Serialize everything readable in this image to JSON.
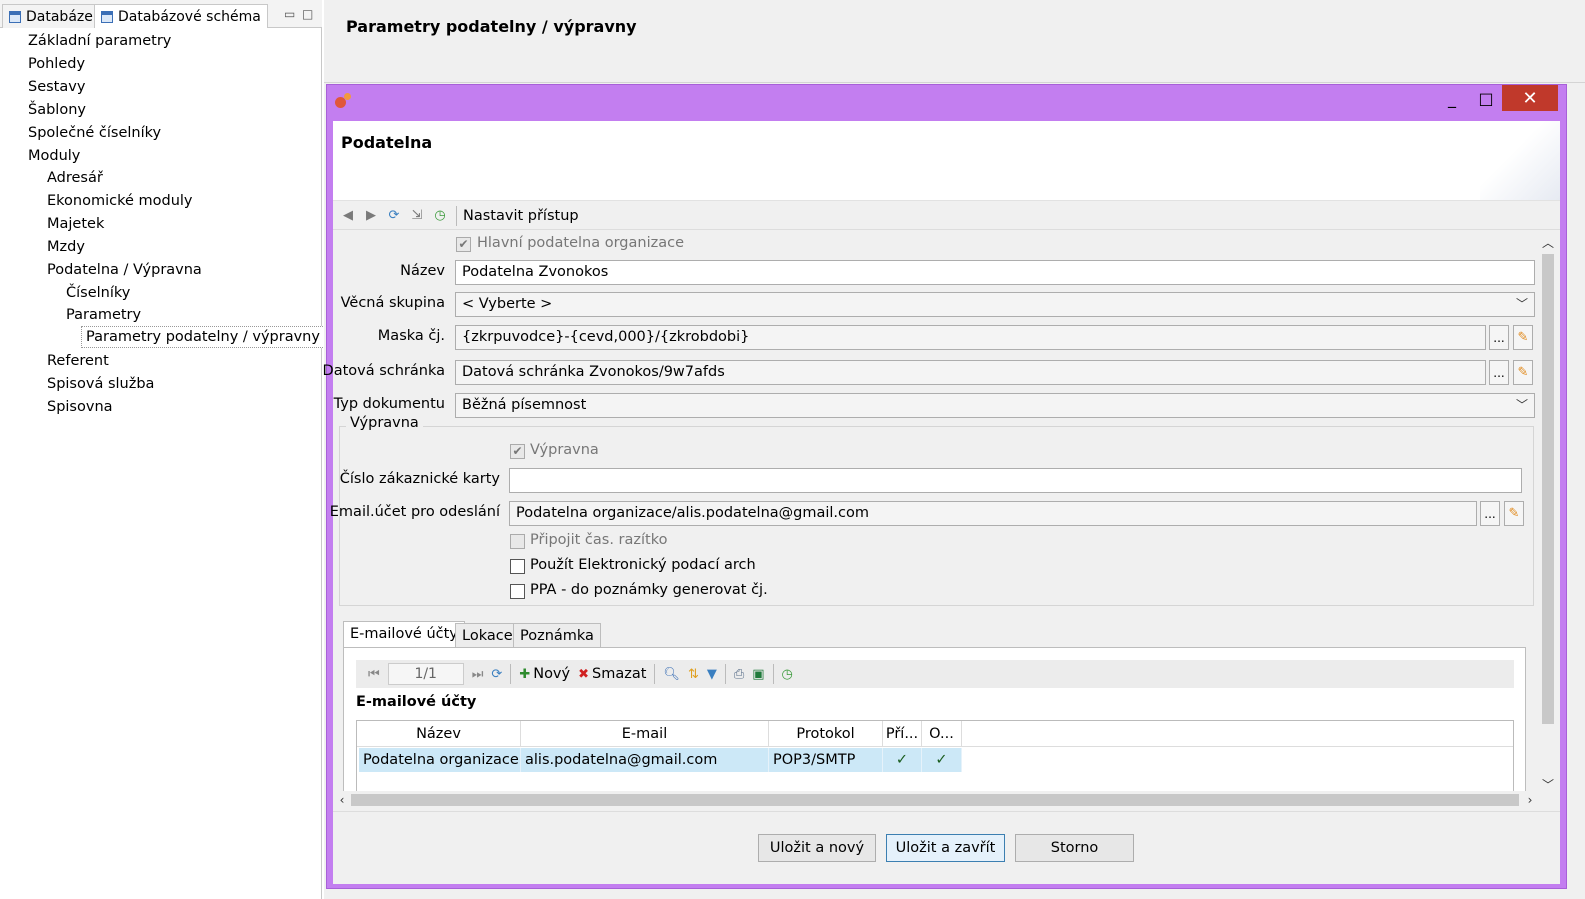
{
  "left_panel": {
    "tabs": [
      {
        "label": "Databáze",
        "icon": "table-view-icon"
      },
      {
        "label": "Databázové schéma",
        "icon": "table-view-icon"
      }
    ],
    "tree": [
      {
        "label": "Základní parametry"
      },
      {
        "label": "Pohledy"
      },
      {
        "label": "Sestavy"
      },
      {
        "label": "Šablony"
      },
      {
        "label": "Společné číselníky"
      },
      {
        "label": "Moduly"
      },
      {
        "label": "Adresář"
      },
      {
        "label": "Ekonomické moduly"
      },
      {
        "label": "Majetek"
      },
      {
        "label": "Mzdy"
      },
      {
        "label": "Podatelna / Výpravna"
      },
      {
        "label": "Číselníky"
      },
      {
        "label": "Parametry"
      },
      {
        "label": "Parametry podatelny / výpravny",
        "selected": true
      },
      {
        "label": "Referent"
      },
      {
        "label": "Spisová služba"
      },
      {
        "label": "Spisovna"
      }
    ]
  },
  "page": {
    "title": "Parametry podatelny / výpravny"
  },
  "dialog": {
    "form_title": "Podatelna",
    "toolbar": {
      "access_label": "Nastavit přístup"
    },
    "fields": {
      "main_org_label": "Hlavní podatelna organizace",
      "main_org_checked": true,
      "name_label": "Název",
      "name_value": "Podatelna Zvonokos",
      "group_label": "Věcná skupina",
      "group_value": "< Vyberte >",
      "mask_label": "Maska čj.",
      "mask_value": "{zkrpuvodce}-{cevd,000}/{zkrobdobi}",
      "databox_label": "Datová schránka",
      "databox_value": "Datová schránka Zvonokos/9w7afds",
      "doctype_label": "Typ dokumentu",
      "doctype_value": "Běžná písemnost",
      "ellipsis": "..."
    },
    "vypravna": {
      "legend": "Výpravna",
      "vypravna_label": "Výpravna",
      "vypravna_checked": true,
      "card_label": "Číslo zákaznické karty",
      "card_value": "",
      "email_label": "Email.účet pro odeslání",
      "email_value": "Podatelna organizace/alis.podatelna@gmail.com",
      "timestamp_label": "Připojit čas. razítko",
      "timestamp_checked": false,
      "electronic_label": "Použít Elektronický podací arch",
      "electronic_checked": false,
      "ppa_label": "PPA - do poznámky generovat čj.",
      "ppa_checked": false
    },
    "tabs": [
      {
        "label": "E-mailové účty",
        "active": true
      },
      {
        "label": "Lokace"
      },
      {
        "label": "Poznámka"
      }
    ],
    "grid_toolbar": {
      "pager": "1/1",
      "new_label": "Nový",
      "delete_label": "Smazat"
    },
    "grid": {
      "title": "E-mailové účty",
      "columns": [
        "Název",
        "E-mail",
        "Protokol",
        "Pří...",
        "O..."
      ],
      "rows": [
        {
          "name": "Podatelna organizace",
          "email": "alis.podatelna@gmail.com",
          "protocol": "POP3/SMTP",
          "col4": "✓",
          "col5": "✓"
        }
      ]
    },
    "footer": {
      "save_new": "Uložit a nový",
      "save_close": "Uložit a zavřít",
      "cancel": "Storno"
    }
  },
  "colors": {
    "dialog_frame": "#c37ef0",
    "selected_row": "#cce8f7",
    "close_button": "#c0392b"
  }
}
